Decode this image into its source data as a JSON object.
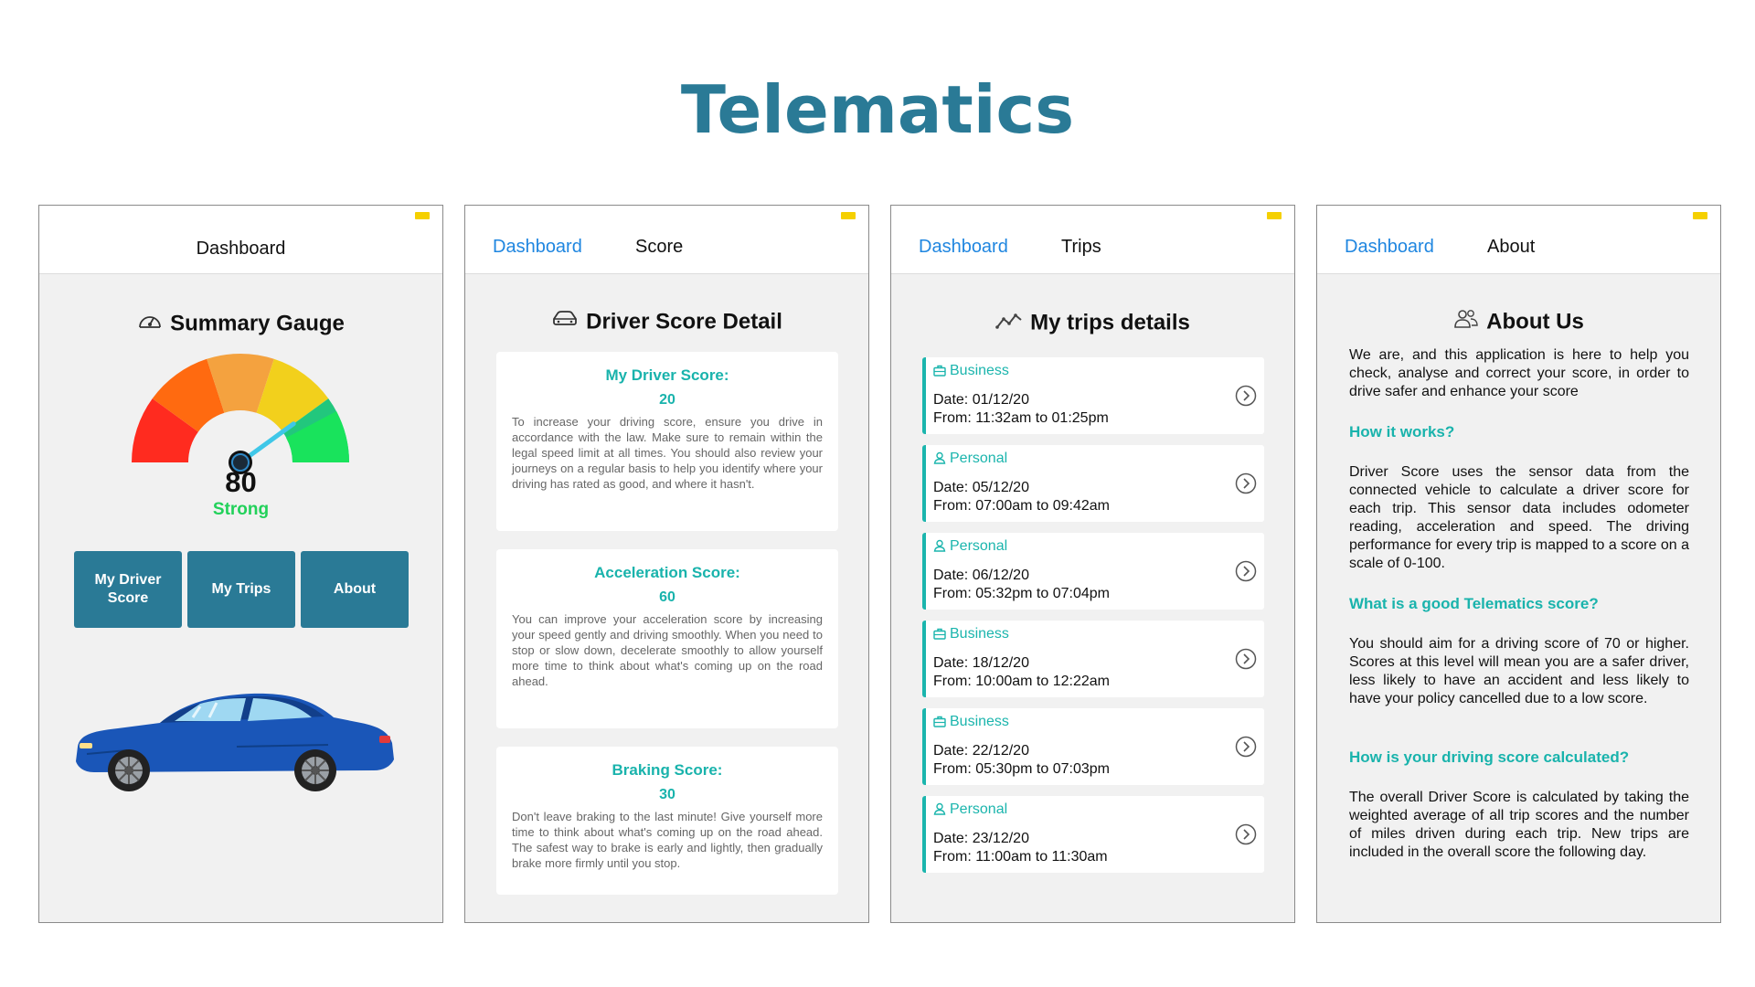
{
  "page_title": "Telematics",
  "colors": {
    "brand": "#2a7a96",
    "accent_teal": "#19b3ac",
    "link_blue": "#1f86e0",
    "strong_green": "#22d15a",
    "status_notch": "#f5d000"
  },
  "dashboard": {
    "header_title": "Dashboard",
    "section_title": "Summary Gauge",
    "section_icon": "speedometer-icon",
    "gauge": {
      "value": "80",
      "label": "Strong",
      "needle_fraction": 0.8
    },
    "buttons": [
      "My Driver Score",
      "My Trips",
      "About"
    ],
    "image": "blue-sedan-car"
  },
  "score": {
    "nav_link": "Dashboard",
    "header_title": "Score",
    "section_title": "Driver Score Detail",
    "section_icon": "car-icon",
    "cards": [
      {
        "title": "My Driver Score:",
        "value": "20",
        "text": "To increase your driving score, ensure you drive in accordance with the law. Make sure to remain within the legal speed limit at all times. You should also review your journeys on a regular basis to help you identify where your driving has rated as good, and where it hasn't."
      },
      {
        "title": "Acceleration Score:",
        "value": "60",
        "text": "You can improve your acceleration score by increasing your speed gently and driving smoothly. When you need to stop or slow down, decelerate smoothly to allow yourself more time to think about what's coming up on the road ahead."
      },
      {
        "title": "Braking Score:",
        "value": "30",
        "text": "Don't leave braking to the last minute! Give yourself more time to think about what's coming up on the road ahead. The safest way to brake is early and lightly, then gradually brake more firmly until you stop."
      }
    ]
  },
  "trips": {
    "nav_link": "Dashboard",
    "header_title": "Trips",
    "section_title": "My trips details",
    "section_icon": "trend-line-icon",
    "items": [
      {
        "type": "Business",
        "icon": "briefcase-icon",
        "date": "Date: 01/12/20",
        "time": "From: 11:32am to 01:25pm"
      },
      {
        "type": "Personal",
        "icon": "person-icon",
        "date": "Date: 05/12/20",
        "time": "From: 07:00am to 09:42am"
      },
      {
        "type": "Personal",
        "icon": "person-icon",
        "date": "Date: 06/12/20",
        "time": "From: 05:32pm to 07:04pm"
      },
      {
        "type": "Business",
        "icon": "briefcase-icon",
        "date": "Date: 18/12/20",
        "time": "From: 10:00am to 12:22am"
      },
      {
        "type": "Business",
        "icon": "briefcase-icon",
        "date": "Date: 22/12/20",
        "time": "From: 05:30pm to 07:03pm"
      },
      {
        "type": "Personal",
        "icon": "person-icon",
        "date": "Date: 23/12/20",
        "time": "From: 11:00am to 11:30am"
      }
    ]
  },
  "about": {
    "nav_link": "Dashboard",
    "header_title": "About",
    "section_title": "About Us",
    "section_icon": "people-icon",
    "intro": "We are, and this application is here to help you check, analyse and correct your score, in order to drive safer and enhance your score",
    "sections": [
      {
        "heading": "How it works?",
        "text": "Driver Score uses the sensor data from the connected vehicle to calculate a driver score for each trip. This sensor data includes odometer reading, acceleration and speed. The driving performance for every trip is mapped to a score on a scale of 0-100."
      },
      {
        "heading": "What is a good Telematics score?",
        "text": "You should aim for a driving score of 70 or higher. Scores at this level will mean you are a safer driver, less likely to have an accident and less likely to have your policy cancelled due to a low score."
      },
      {
        "heading": "How is your driving score calculated?",
        "text": "The overall Driver Score is calculated by taking the weighted average of all trip scores and the number of miles driven during each trip. New trips are included in the overall score the following day."
      }
    ]
  }
}
